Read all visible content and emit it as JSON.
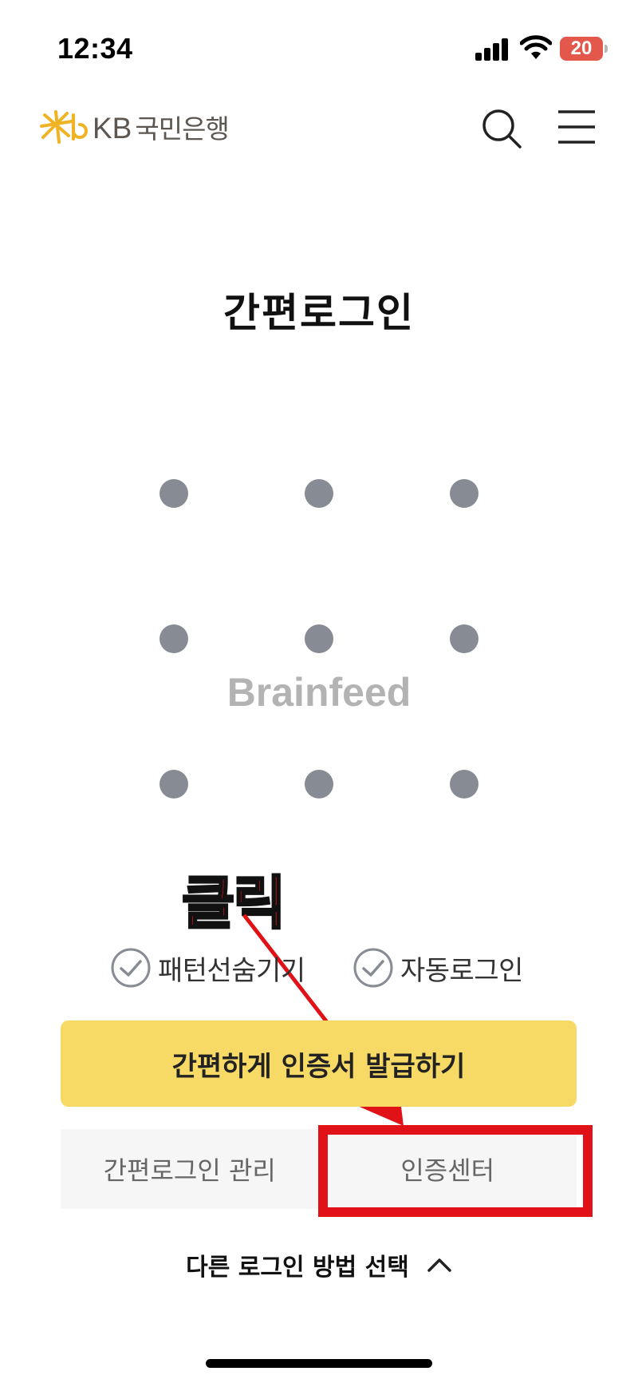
{
  "status_bar": {
    "time": "12:34",
    "battery": "20"
  },
  "header": {
    "brand_prefix": "KB",
    "brand_name": "국민은행",
    "search_icon": "search-icon",
    "menu_icon": "menu-icon"
  },
  "page_title": "간편로그인",
  "pattern": {
    "rows": 3,
    "columns": 3,
    "dot_color": "#868b94"
  },
  "watermark": "Brainfeed",
  "annotation": {
    "label": "클릭",
    "color": "#e01218"
  },
  "options": [
    {
      "label": "패턴선숨기기",
      "checked": true
    },
    {
      "label": "자동로그인",
      "checked": true
    }
  ],
  "primary_button": {
    "label": "간편하게 인증서 발급하기",
    "color": "#f7d966"
  },
  "secondary_buttons": [
    {
      "label": "간편로그인 관리"
    },
    {
      "label": "인증센터"
    }
  ],
  "other_login": {
    "label": "다른 로그인 방법 선택",
    "icon": "chevron-up-icon"
  }
}
